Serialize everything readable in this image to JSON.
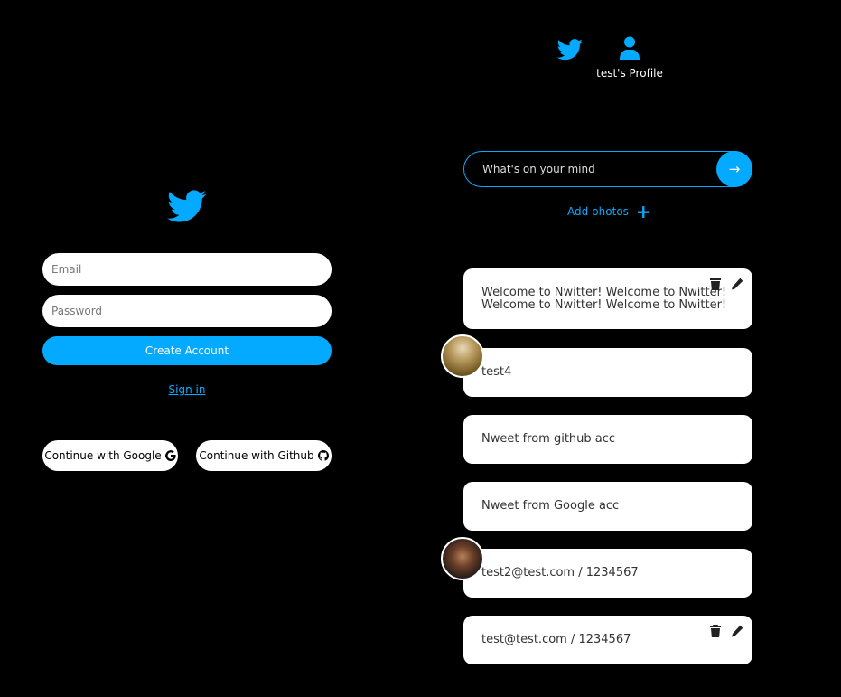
{
  "auth": {
    "email_placeholder": "Email",
    "password_placeholder": "Password",
    "create_account_label": "Create Account",
    "sign_in_label": "Sign in",
    "google_label": "Continue with Google",
    "github_label": "Continue with Github"
  },
  "nav": {
    "home_icon": "twitter-bird-icon",
    "profile_icon": "user-icon",
    "profile_label": "test's Profile"
  },
  "composer": {
    "placeholder": "What's on your mind",
    "submit_label": "→",
    "add_photos_label": "Add photos",
    "add_photos_icon": "+"
  },
  "nweets": [
    {
      "text": "Welcome to Nwitter! Welcome to Nwitter! Welcome to Nwitter! Welcome to Nwitter!",
      "owner": true
    },
    {
      "text": "test4",
      "owner": false,
      "has_image": true
    },
    {
      "text": "Nweet from github acc",
      "owner": false
    },
    {
      "text": "Nweet from Google acc",
      "owner": false
    },
    {
      "text": "test2@test.com / 1234567",
      "owner": false,
      "has_image": true
    },
    {
      "text": "test@test.com / 1234567",
      "owner": true
    }
  ],
  "colors": {
    "accent": "#04aaff",
    "background": "#000000",
    "card": "#ffffff"
  }
}
